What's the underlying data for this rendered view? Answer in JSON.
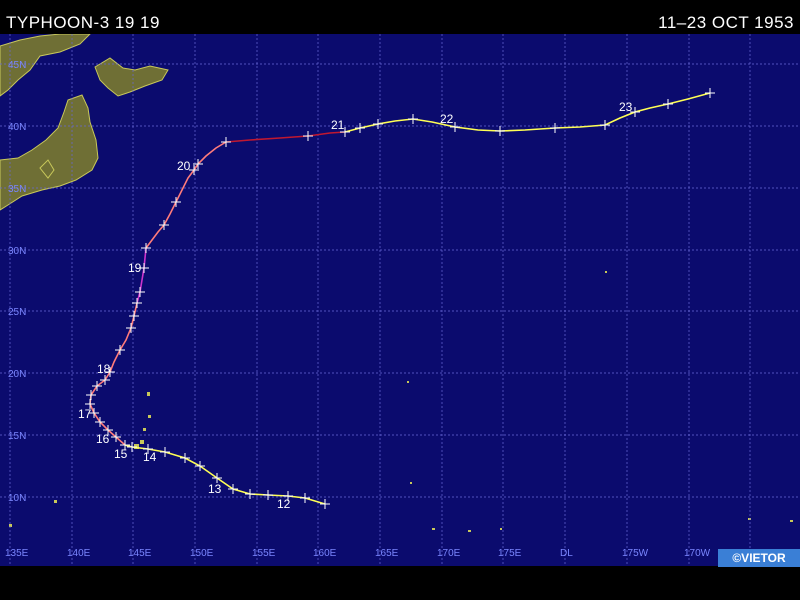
{
  "header": {
    "storm_title": "TYPHOON-3 19 19",
    "date_range": "11–23 OCT 1953"
  },
  "credit": "©VIETOR",
  "axes": {
    "lat_labels": [
      "10N",
      "15N",
      "20N",
      "25N",
      "30N",
      "35N",
      "40N",
      "45N"
    ],
    "lon_labels": [
      "135E",
      "140E",
      "145E",
      "150E",
      "155E",
      "160E",
      "165E",
      "170E",
      "175E",
      "DL",
      "175W",
      "170W"
    ]
  },
  "track_days": [
    "12",
    "13",
    "14",
    "15",
    "16",
    "17",
    "18",
    "19",
    "20",
    "21",
    "22",
    "23"
  ],
  "colors": {
    "ocean": "#0b0b6e",
    "land": "#6f6f35",
    "coast": "#c8c85a",
    "grid": "#6a6ad8",
    "tropical_storm": "#ffff55",
    "typhoon_cat1": "#ff7b7b",
    "typhoon_cat2": "#ff4040",
    "typhoon_cat3": "#cc33cc",
    "extratropical": "#c01830"
  }
}
